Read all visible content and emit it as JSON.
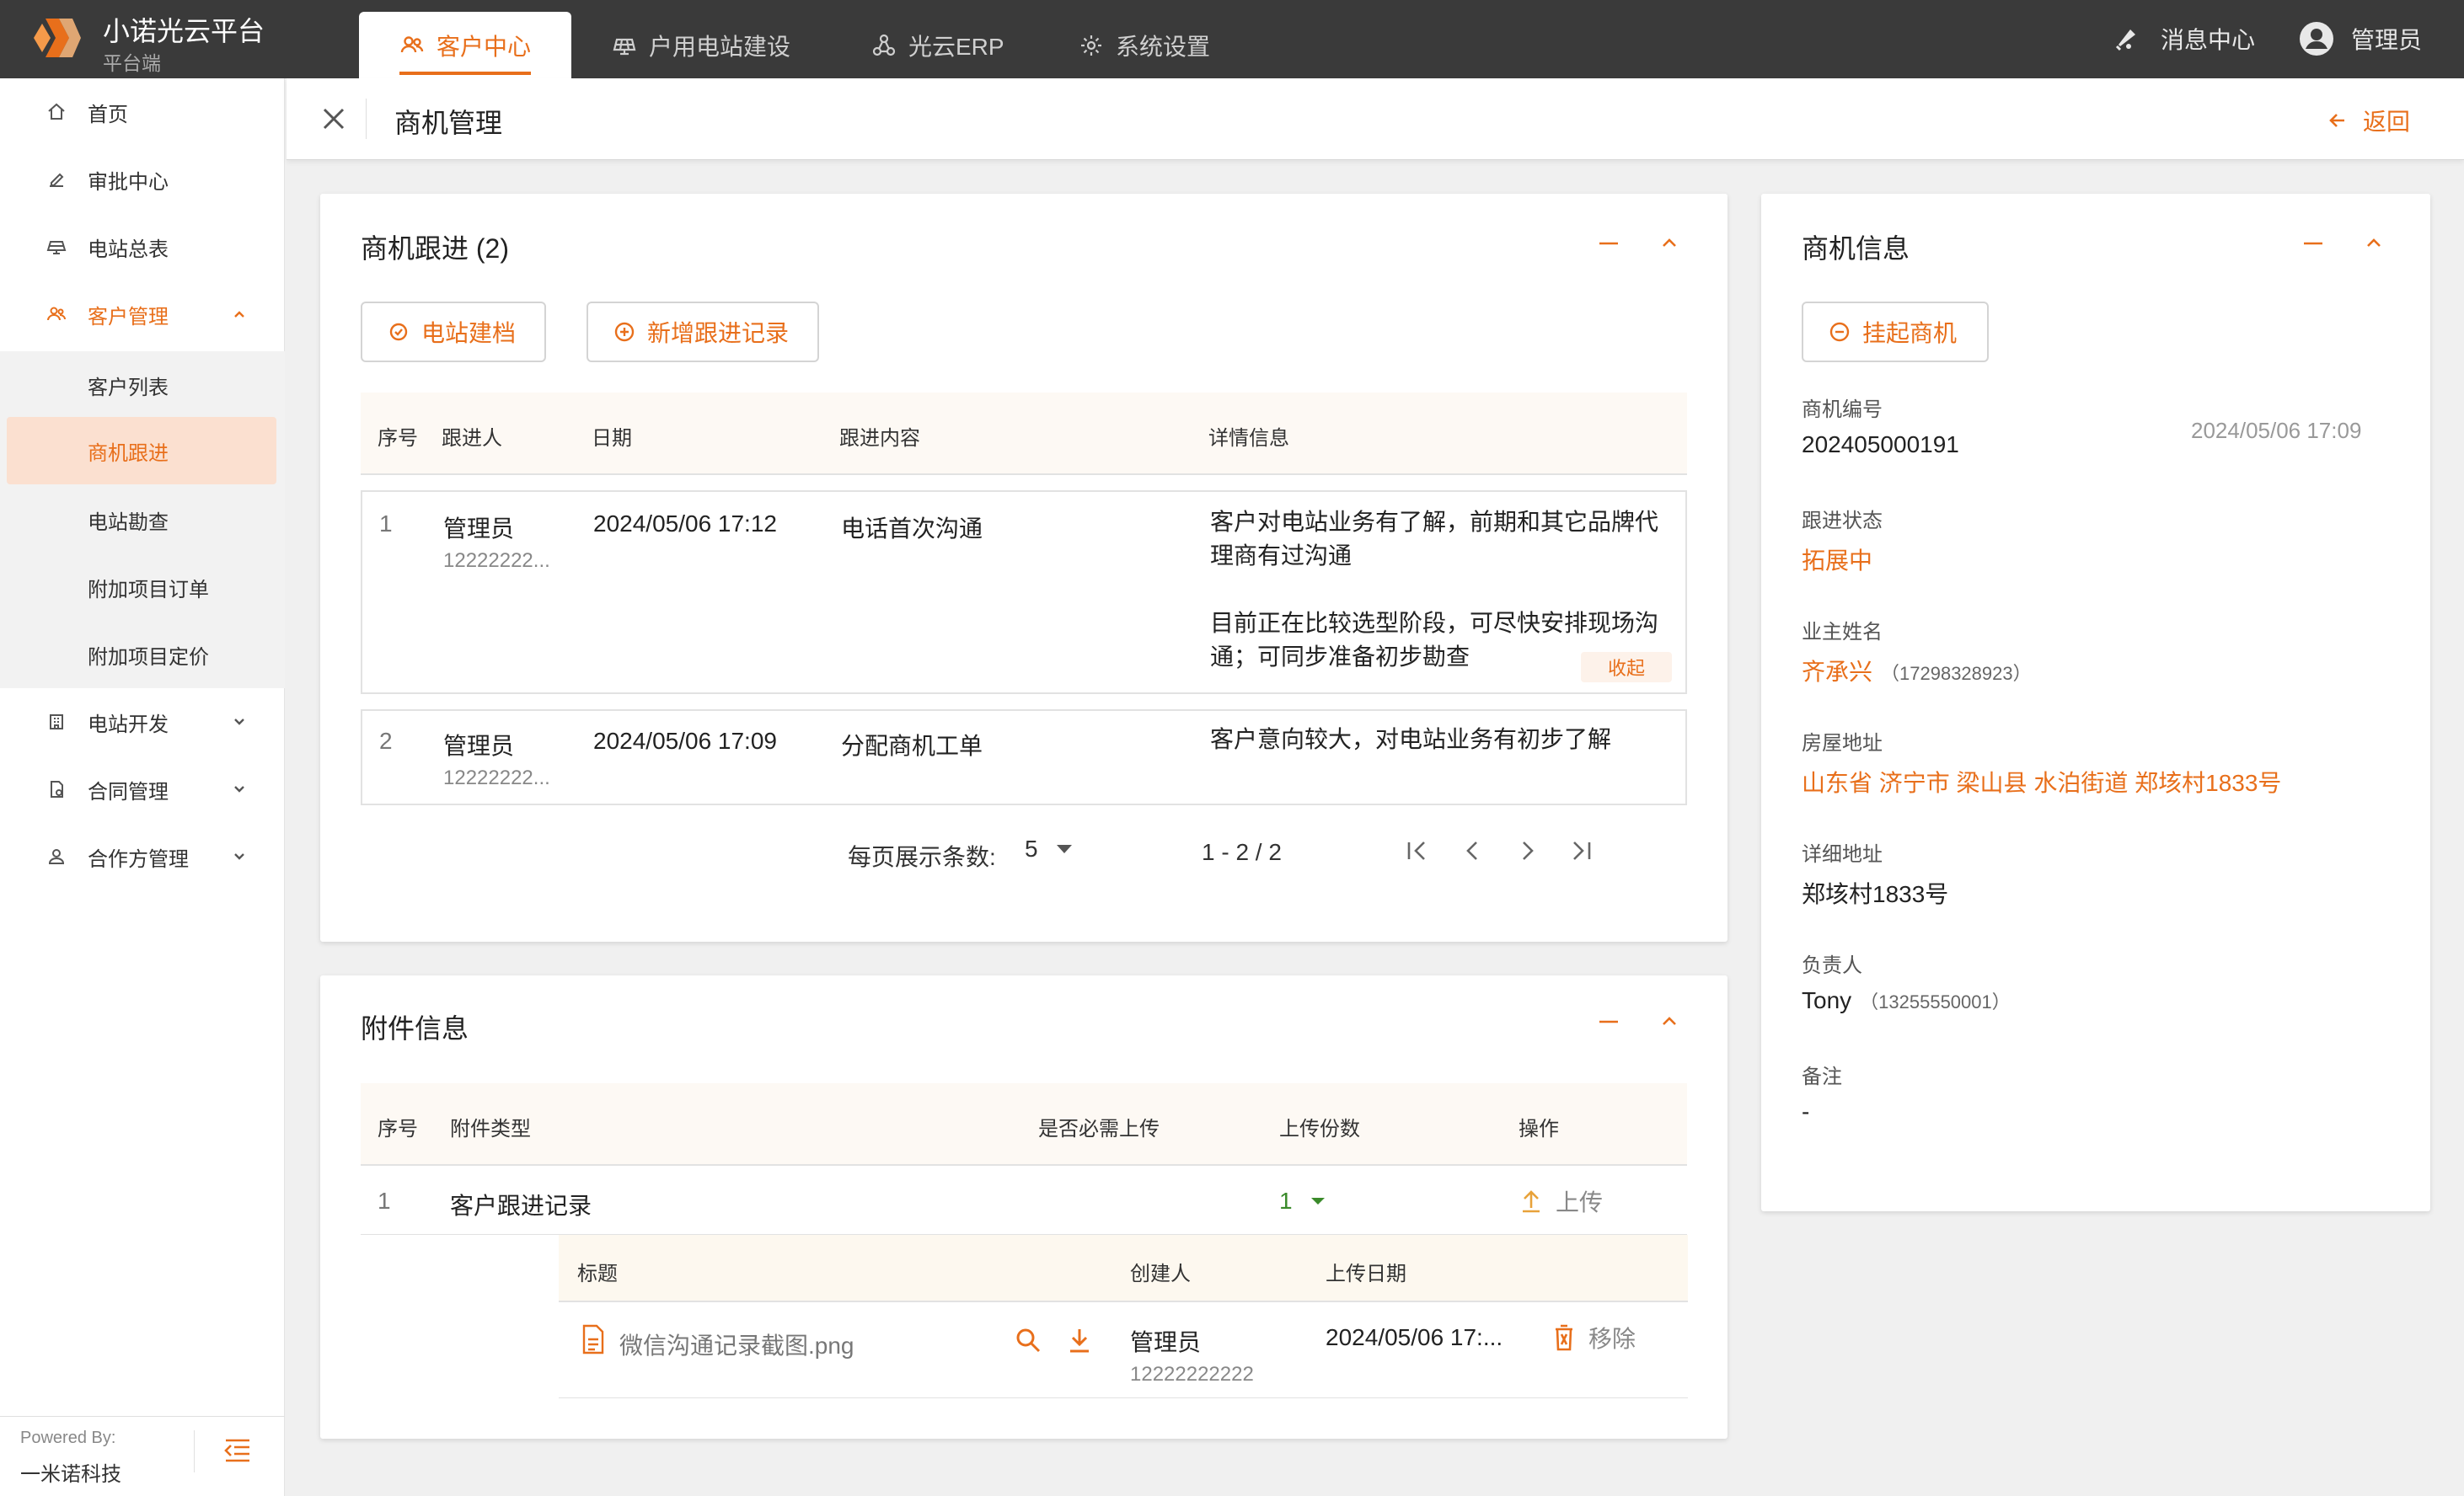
{
  "brand": {
    "title": "小诺光云平台",
    "subtitle": "平台端"
  },
  "top_tabs": [
    {
      "label": "客户中心",
      "icon": "customers-icon",
      "active": true
    },
    {
      "label": "户用电站建设",
      "icon": "solar-panel-icon",
      "active": false
    },
    {
      "label": "光云ERP",
      "icon": "network-icon",
      "active": false
    },
    {
      "label": "系统设置",
      "icon": "gear-icon",
      "active": false
    }
  ],
  "top_right": {
    "messages": "消息中心",
    "user": "管理员"
  },
  "sidebar": {
    "items": [
      {
        "label": "首页",
        "icon": "home-icon"
      },
      {
        "label": "审批中心",
        "icon": "pen-icon"
      },
      {
        "label": "电站总表",
        "icon": "solar-panel-icon"
      },
      {
        "label": "客户管理",
        "icon": "customers-icon",
        "expanded": true
      },
      {
        "label": "电站开发",
        "icon": "building-icon"
      },
      {
        "label": "合同管理",
        "icon": "contract-icon"
      },
      {
        "label": "合作方管理",
        "icon": "partner-icon"
      }
    ],
    "sub_items": [
      {
        "label": "客户列表"
      },
      {
        "label": "商机跟进",
        "active": true
      },
      {
        "label": "电站勘查"
      },
      {
        "label": "附加项目订单"
      },
      {
        "label": "附加项目定价"
      }
    ],
    "footer": {
      "powered_by": "Powered By:",
      "company": "一米诺科技"
    }
  },
  "page_header": {
    "title": "商机管理",
    "back": "返回"
  },
  "followup": {
    "title": "商机跟进 (2)",
    "buttons": {
      "archive": "电站建档",
      "add": "新增跟进记录"
    },
    "columns": [
      "序号",
      "跟进人",
      "日期",
      "跟进内容",
      "详情信息"
    ],
    "rows": [
      {
        "idx": "1",
        "person": "管理员",
        "phone": "12222222...",
        "date": "2024/05/06 17:12",
        "content": "电话首次沟通",
        "detail_lines": [
          "客户对电站业务有了解，前期和其它品牌代",
          "理商有过沟通",
          "",
          "目前正在比较选型阶段，可尽快安排现场沟",
          "通；可同步准备初步勘查"
        ],
        "collapse": "收起"
      },
      {
        "idx": "2",
        "person": "管理员",
        "phone": "12222222...",
        "date": "2024/05/06 17:09",
        "content": "分配商机工单",
        "detail_lines": [
          "客户意向较大，对电站业务有初步了解"
        ]
      }
    ],
    "pagination": {
      "per_page_label": "每页展示条数:",
      "per_page": "5",
      "range": "1 - 2 / 2"
    }
  },
  "attachments": {
    "title": "附件信息",
    "columns": [
      "序号",
      "附件类型",
      "是否必需上传",
      "上传份数",
      "操作"
    ],
    "rows": [
      {
        "idx": "1",
        "type": "客户跟进记录",
        "required": "",
        "count": "1",
        "action": "上传"
      }
    ],
    "sub_columns": [
      "标题",
      "创建人",
      "上传日期"
    ],
    "files": [
      {
        "name": "微信沟通记录截图.png",
        "creator": "管理员",
        "creator_phone": "12222222222",
        "date": "2024/05/06 17:...",
        "remove": "移除"
      }
    ]
  },
  "info": {
    "title": "商机信息",
    "hang_button": "挂起商机",
    "fields": [
      {
        "label": "商机编号",
        "value": "202405000191",
        "aside": "2024/05/06 17:09"
      },
      {
        "label": "跟进状态",
        "value": "拓展中"
      },
      {
        "label": "业主姓名",
        "value": "齐承兴",
        "extra": "（17298328923）"
      },
      {
        "label": "房屋地址",
        "value": "山东省 济宁市 梁山县 水泊街道 郑垓村1833号"
      },
      {
        "label": "详细地址",
        "value": "郑垓村1833号"
      },
      {
        "label": "负责人",
        "value": "Tony",
        "extra": "（13255550001）"
      },
      {
        "label": "备注",
        "value": "-"
      }
    ]
  },
  "colors": {
    "accent": "#e86f1b",
    "topbar": "#3a3a3a",
    "active_bg": "#fbe0d0",
    "green": "#3a8a2a"
  }
}
